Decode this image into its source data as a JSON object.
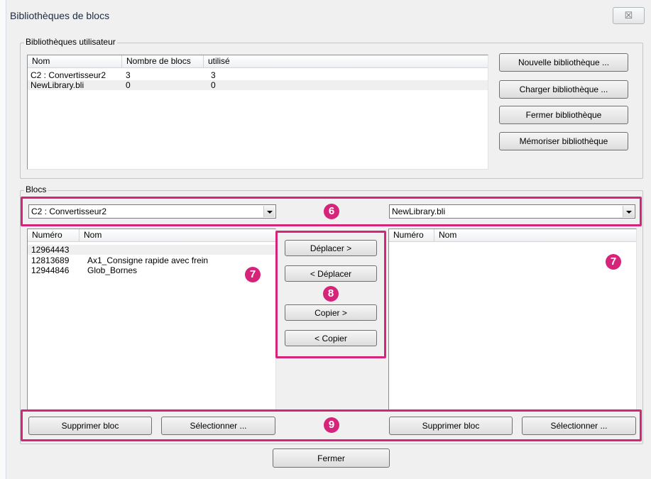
{
  "window": {
    "title": "Bibliothèques de blocs",
    "close_glyph": "☒"
  },
  "user_libraries": {
    "group_label": "Bibliothèques utilisateur",
    "columns": [
      "Nom",
      "Nombre de blocs",
      "utilisé"
    ],
    "rows": [
      {
        "nom": "C2 : Convertisseur2",
        "nombre": "3",
        "utilise": "3"
      },
      {
        "nom": "NewLibrary.bli",
        "nombre": "0",
        "utilise": "0"
      }
    ],
    "buttons": {
      "new": "Nouvelle bibliothèque ...",
      "load": "Charger bibliothèque ...",
      "close": "Fermer bibliothèque",
      "save": "Mémoriser bibliothèque"
    }
  },
  "blocks": {
    "group_label": "Blocs",
    "left": {
      "selected_library": "C2 : Convertisseur2",
      "columns": [
        "Numéro",
        "Nom"
      ],
      "rows": [
        {
          "numero": "12964443",
          "nom": ""
        },
        {
          "numero": "12813689",
          "nom": "Ax1_Consigne rapide avec frein"
        },
        {
          "numero": "12944846",
          "nom": "Glob_Bornes"
        }
      ],
      "delete_button": "Supprimer bloc",
      "select_button": "Sélectionner ..."
    },
    "right": {
      "selected_library": "NewLibrary.bli",
      "columns": [
        "Numéro",
        "Nom"
      ],
      "rows": [],
      "delete_button": "Supprimer bloc",
      "select_button": "Sélectionner ..."
    },
    "transfer_buttons": {
      "move_right": "Déplacer >",
      "move_left": "< Déplacer",
      "copy_right": "Copier >",
      "copy_left": "< Copier"
    }
  },
  "footer": {
    "close_button": "Fermer"
  },
  "callouts": {
    "b6": "6",
    "b7a": "7",
    "b7b": "7",
    "b8": "8",
    "b9": "9"
  },
  "colors": {
    "highlight": "#d6247a",
    "window_bg": "#f0f0f0"
  }
}
